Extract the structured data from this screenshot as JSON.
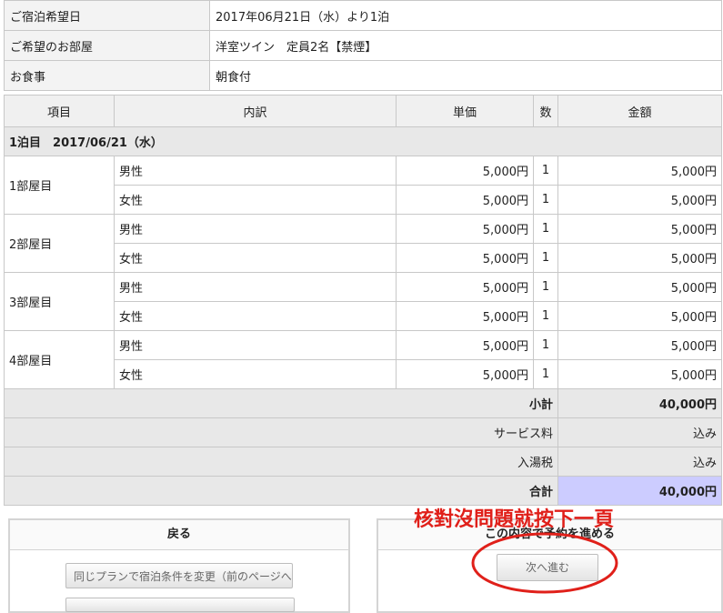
{
  "reservation": {
    "date_label": "ご宿泊希望日",
    "date_value": "2017年06月21日（水）より1泊",
    "room_label": "ご希望のお部屋",
    "room_value": "洋室ツイン　定員2名【禁煙】",
    "meal_label": "お食事",
    "meal_value": "朝食付"
  },
  "headers": {
    "item": "項目",
    "detail": "内訳",
    "price": "単価",
    "qty": "数",
    "amount": "金額"
  },
  "day_label": "1泊目　2017/06/21（水）",
  "rooms": [
    {
      "name": "1部屋目",
      "male": "男性",
      "female": "女性",
      "male_price": "5,000円",
      "male_qty": "1",
      "male_amount": "5,000円",
      "female_price": "5,000円",
      "female_qty": "1",
      "female_amount": "5,000円"
    },
    {
      "name": "2部屋目",
      "male": "男性",
      "female": "女性",
      "male_price": "5,000円",
      "male_qty": "1",
      "male_amount": "5,000円",
      "female_price": "5,000円",
      "female_qty": "1",
      "female_amount": "5,000円"
    },
    {
      "name": "3部屋目",
      "male": "男性",
      "female": "女性",
      "male_price": "5,000円",
      "male_qty": "1",
      "male_amount": "5,000円",
      "female_price": "5,000円",
      "female_qty": "1",
      "female_amount": "5,000円"
    },
    {
      "name": "4部屋目",
      "male": "男性",
      "female": "女性",
      "male_price": "5,000円",
      "male_qty": "1",
      "male_amount": "5,000円",
      "female_price": "5,000円",
      "female_qty": "1",
      "female_amount": "5,000円"
    }
  ],
  "summary": {
    "subtotal_label": "小計",
    "subtotal_value": "40,000円",
    "service_label": "サービス料",
    "service_value": "込み",
    "tax_label": "入湯税",
    "tax_value": "込み",
    "total_label": "合計",
    "total_value": "40,000円"
  },
  "back_panel": {
    "title": "戻る",
    "change_button": "同じプランで宿泊条件を変更（前のページへ"
  },
  "next_panel": {
    "title": "この内容で予約を進める",
    "next_button": "次へ進む"
  },
  "annotation": {
    "text": "核對沒問題就按下一頁",
    "color": "#e0201a"
  }
}
